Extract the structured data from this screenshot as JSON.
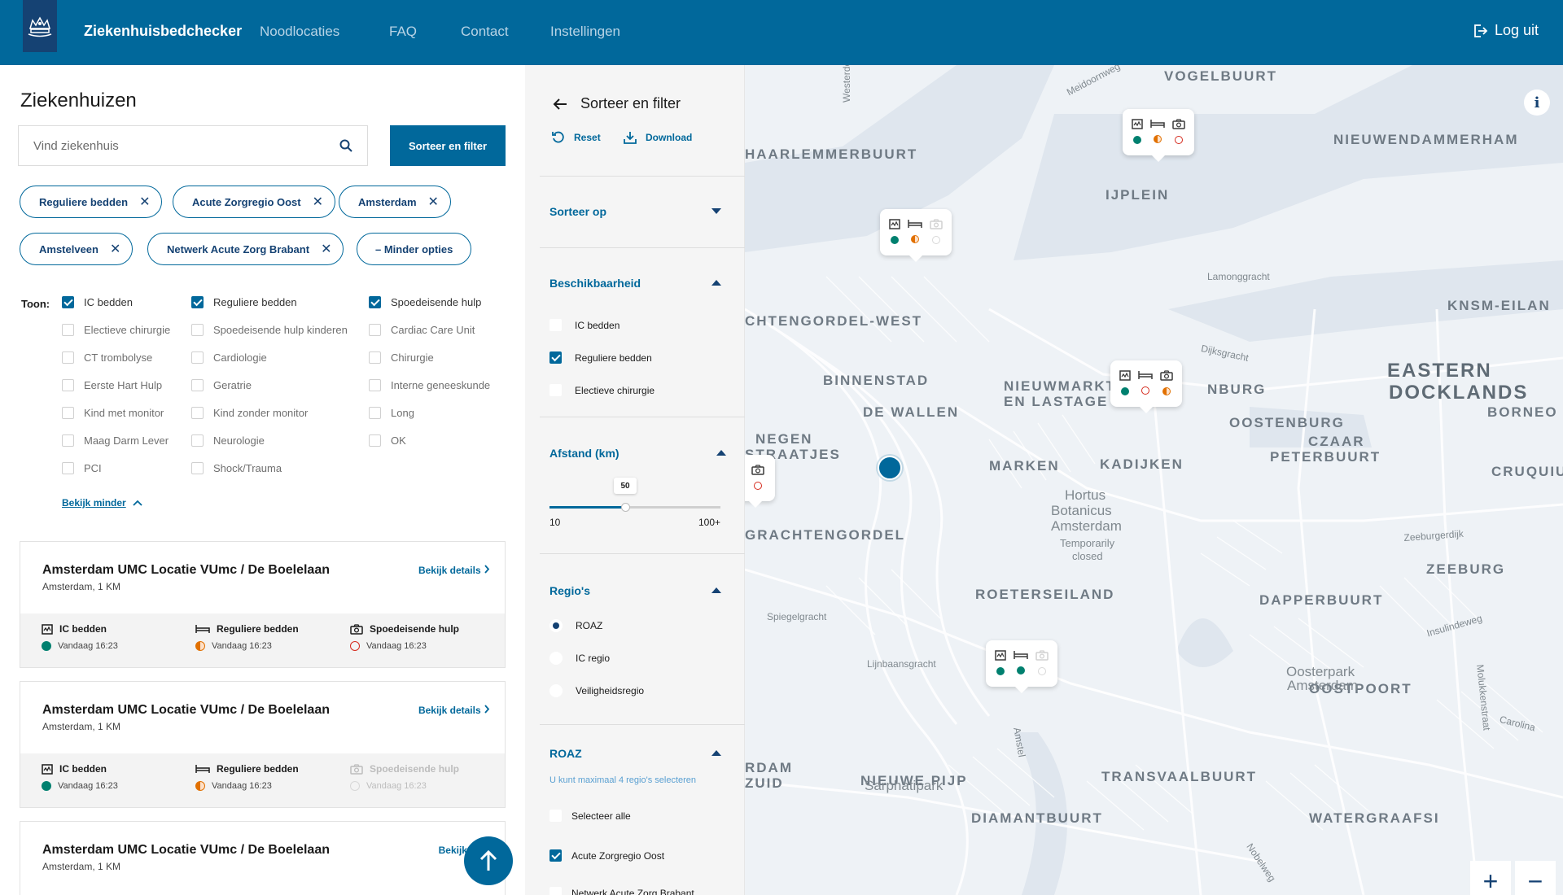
{
  "header": {
    "brand": "Ziekenhuisbedchecker",
    "nav": [
      "Noodlocaties",
      "FAQ",
      "Contact",
      "Instellingen"
    ],
    "logout": "Log uit"
  },
  "left": {
    "title": "Ziekenhuizen",
    "search_placeholder": "Vind ziekenhuis",
    "sort_filter_button": "Sorteer en filter",
    "chips": [
      "Reguliere bedden",
      "Acute Zorgregio Oost",
      "Amsterdam",
      "Amstelveen",
      "Netwerk Acute Zorg Brabant"
    ],
    "less_options": "– Minder opties",
    "toon_label": "Toon:",
    "checkboxes": [
      {
        "label": "IC bedden",
        "checked": true
      },
      {
        "label": "Reguliere bedden",
        "checked": true
      },
      {
        "label": "Spoedeisende hulp",
        "checked": true
      },
      {
        "label": "Electieve chirurgie",
        "checked": false
      },
      {
        "label": "Spoedeisende hulp kinderen",
        "checked": false
      },
      {
        "label": "Cardiac Care Unit",
        "checked": false
      },
      {
        "label": "CT trombolyse",
        "checked": false
      },
      {
        "label": "Cardiologie",
        "checked": false
      },
      {
        "label": "Chirurgie",
        "checked": false
      },
      {
        "label": "Eerste Hart Hulp",
        "checked": false
      },
      {
        "label": "Geratrie",
        "checked": false
      },
      {
        "label": "Interne geneeskunde",
        "checked": false
      },
      {
        "label": "Kind met monitor",
        "checked": false
      },
      {
        "label": "Kind zonder monitor",
        "checked": false
      },
      {
        "label": "Long",
        "checked": false
      },
      {
        "label": "Maag Darm Lever",
        "checked": false
      },
      {
        "label": "Neurologie",
        "checked": false
      },
      {
        "label": "OK",
        "checked": false
      },
      {
        "label": "PCI",
        "checked": false
      },
      {
        "label": "Shock/Trauma",
        "checked": false
      }
    ],
    "show_less": "Bekijk minder",
    "cards": [
      {
        "name": "Amsterdam UMC Locatie VUmc / De Boelelaan",
        "location": "Amsterdam, 1 KM",
        "link": "Bekijk details",
        "stats": [
          {
            "label": "IC bedden",
            "time": "Vandaag 16:23",
            "status": "green"
          },
          {
            "label": "Reguliere bedden",
            "time": "Vandaag 16:23",
            "status": "half"
          },
          {
            "label": "Spoedeisende hulp",
            "time": "Vandaag 16:23",
            "status": "empty"
          }
        ]
      },
      {
        "name": "Amsterdam UMC Locatie VUmc / De Boelelaan",
        "location": "Amsterdam, 1 KM",
        "link": "Bekijk details",
        "stats": [
          {
            "label": "IC bedden",
            "time": "Vandaag 16:23",
            "status": "green"
          },
          {
            "label": "Reguliere bedden",
            "time": "Vandaag 16:23",
            "status": "half"
          },
          {
            "label": "Spoedeisende hulp",
            "time": "Vandaag 16:23",
            "status": "grey"
          }
        ]
      },
      {
        "name": "Amsterdam UMC Locatie VUmc / De Boelelaan",
        "location": "Amsterdam, 1 KM",
        "link": "Bekijk deta"
      }
    ]
  },
  "filter": {
    "title": "Sorteer en filter",
    "reset": "Reset",
    "download": "Download",
    "sort_section": "Sorteer op",
    "availability_section": "Beschikbaarheid",
    "availability": [
      {
        "label": "IC bedden",
        "checked": false
      },
      {
        "label": "Reguliere bedden",
        "checked": true
      },
      {
        "label": "Electieve chirurgie",
        "checked": false
      }
    ],
    "distance_section": "Afstand (km)",
    "distance_value": "50",
    "distance_value_num": 50,
    "distance_min_label": "10",
    "distance_max_label": "100+",
    "distance_min": 10,
    "distance_max": 100,
    "regions_section": "Regio's",
    "regions": [
      {
        "label": "ROAZ",
        "selected": true
      },
      {
        "label": "IC regio",
        "selected": false
      },
      {
        "label": "Veiligheidsregio",
        "selected": false
      }
    ],
    "roaz_section": "ROAZ",
    "roaz_note": "U kunt maximaal 4 regio's selecteren",
    "roaz_options": [
      {
        "label": "Selecteer alle",
        "checked": false
      },
      {
        "label": "Acute Zorgregio Oost",
        "checked": true
      },
      {
        "label": "Netwerk Acute Zorg Brabant",
        "checked": false
      }
    ]
  },
  "map": {
    "areas": [
      "VOGELBUURT",
      "HAARLEMMERBUURT",
      "NIEUWENDAMMERHAM",
      "IJPLEIN",
      "CHTENGORDEL-WEST",
      "KNSM-EILAN",
      "BINNENSTAD",
      "NIEUWMARKT",
      "EN LASTAGE",
      "NBURG",
      "EASTERN",
      "DOCKLANDS",
      "DE WALLEN",
      "OOSTENBURG",
      "BORNEO",
      "NEGEN",
      "STRAATJES",
      "CZAAR",
      "PETERBUURT",
      "MARKEN",
      "KADIJKEN",
      "CRUQUIU",
      "GRACHTENGORDEL",
      "ZEEBURG",
      "ROETERSEILAND",
      "DAPPERBUURT",
      "OOSTPOORT",
      "TRANSVAALBUURT",
      "NIEUWE PIJP",
      "DIAMANTBUURT",
      "WATERGRAAFSI",
      "RDAM",
      "ZUID"
    ],
    "streets": [
      "Meidoornweg",
      "Westerdok",
      "Lamonggracht",
      "Dijksgracht",
      "Spiegelgracht",
      "Lijnbaansgracht",
      "Amstel",
      "Zeeburgerdijk",
      "Insulindeweg",
      "Molukkenstraat",
      "Carolina",
      "Nobelweg"
    ],
    "pois": [
      "Hortus",
      "Botanicus",
      "Amsterdam",
      "Temporarily",
      "closed",
      "Oosterpark",
      "Amsterdam",
      "Sarphatipark"
    ],
    "info_icon": "i",
    "zoom_in": "+",
    "zoom_out": "−"
  }
}
